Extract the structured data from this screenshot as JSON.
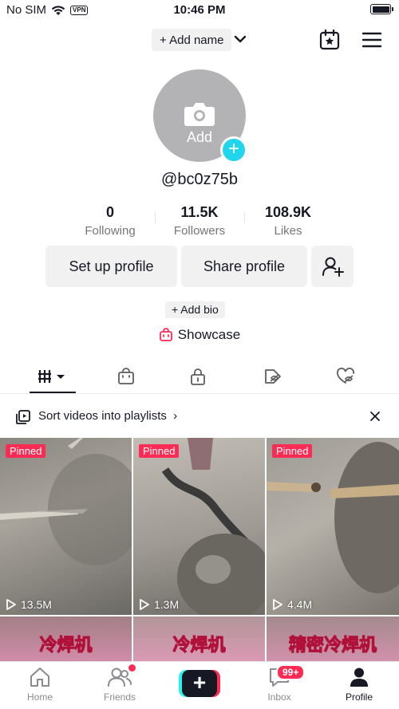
{
  "status_bar": {
    "carrier": "No SIM",
    "vpn_label": "VPN",
    "time": "10:46 PM"
  },
  "header": {
    "add_name_label": "+ Add name"
  },
  "avatar": {
    "label": "Add"
  },
  "profile": {
    "username": "@bc0z75b",
    "stats": [
      {
        "value": "0",
        "label": "Following"
      },
      {
        "value": "11.5K",
        "label": "Followers"
      },
      {
        "value": "108.9K",
        "label": "Likes"
      }
    ],
    "setup_label": "Set up profile",
    "share_label": "Share profile",
    "add_bio_label": "+ Add bio",
    "showcase_label": "Showcase"
  },
  "playlist_banner": {
    "text": "Sort videos into playlists"
  },
  "videos": [
    {
      "pinned": "Pinned",
      "views": "13.5M"
    },
    {
      "pinned": "Pinned",
      "views": "1.3M"
    },
    {
      "pinned": "Pinned",
      "views": "4.4M"
    },
    {
      "title": "冷焊机"
    },
    {
      "title": "冷焊机"
    },
    {
      "title": "精密冷焊机"
    }
  ],
  "bottom_nav": {
    "home": "Home",
    "friends": "Friends",
    "inbox": "Inbox",
    "inbox_badge": "99+",
    "profile": "Profile"
  },
  "colors": {
    "accent": "#fe2c55",
    "teal": "#20d5ec",
    "text": "#161823",
    "muted": "#757575"
  }
}
